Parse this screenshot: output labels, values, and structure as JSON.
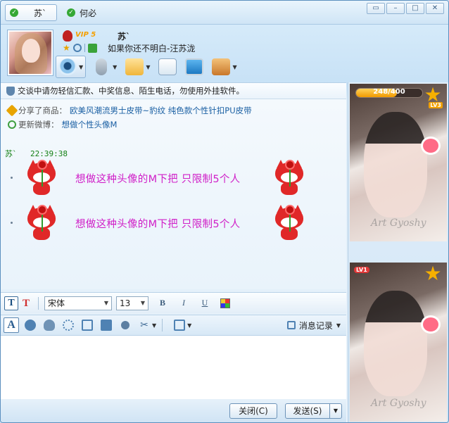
{
  "tabs": [
    {
      "label": "苏`",
      "active": true
    },
    {
      "label": "何必",
      "active": false
    }
  ],
  "window_controls": [
    "restore-icon",
    "minimize-icon",
    "maximize-icon",
    "close-icon"
  ],
  "profile": {
    "vip_label": "VIP 5",
    "nickname": "苏`",
    "signature": "如果你还不明白-汪苏泷"
  },
  "toolbar": {
    "items": [
      "webcam-icon",
      "microphone-icon",
      "file-transfer-icon",
      "remote-assist-icon",
      "screen-share-icon",
      "app-box-icon"
    ]
  },
  "notice": "交谈中请勿轻信汇款、中奖信息、陌生电话，勿使用外挂软件。",
  "share": {
    "label": "分享了商品：",
    "link": "欧美风潮流男士皮带~豹纹 纯色款个性针扣PU皮带"
  },
  "weibo": {
    "label": "更新微博：",
    "link": "想做个性头像M"
  },
  "message": {
    "sender": "苏`",
    "time": "22:39:38",
    "lines": [
      "想做这种头像的M下把 只限制5个人",
      "想做这种头像的M下把 只限制5个人"
    ]
  },
  "format_bar": {
    "font": "宋体",
    "size": "13",
    "bold": "B",
    "italic": "I",
    "underline": "U"
  },
  "emote_bar": {
    "history_label": "消息记录"
  },
  "buttons": {
    "close": "关闭(C)",
    "send": "发送(S)"
  },
  "show_panel": {
    "progress_text": "248/400",
    "progress_value": 0.62,
    "level_top": "LV3",
    "level_bottom": "LV1",
    "watermark": "Art Gyoshy"
  },
  "colors": {
    "message_text": "#d020c8",
    "sender": "#148014",
    "link": "#1a5fa3"
  }
}
